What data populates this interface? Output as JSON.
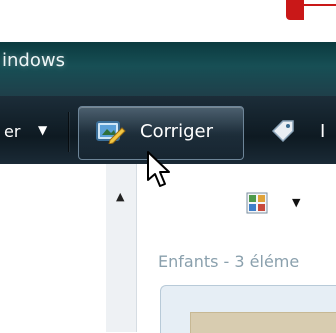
{
  "window": {
    "title_partial": "indows"
  },
  "command_bar": {
    "left_partial_label": "er",
    "corriger_label": "Corriger",
    "next_partial_label": "I"
  },
  "content": {
    "children_label": "Enfants - 3 éléme"
  },
  "colors": {
    "accent_red": "#c91818",
    "titlebar": "#174f55",
    "cmdbar": "#0e1a22",
    "muted_text": "#8aa0ad"
  },
  "icons": {
    "corriger": "edit-picture-icon",
    "tag": "tag-icon",
    "view": "view-options-icon",
    "cursor": "mouse-pointer-icon"
  }
}
